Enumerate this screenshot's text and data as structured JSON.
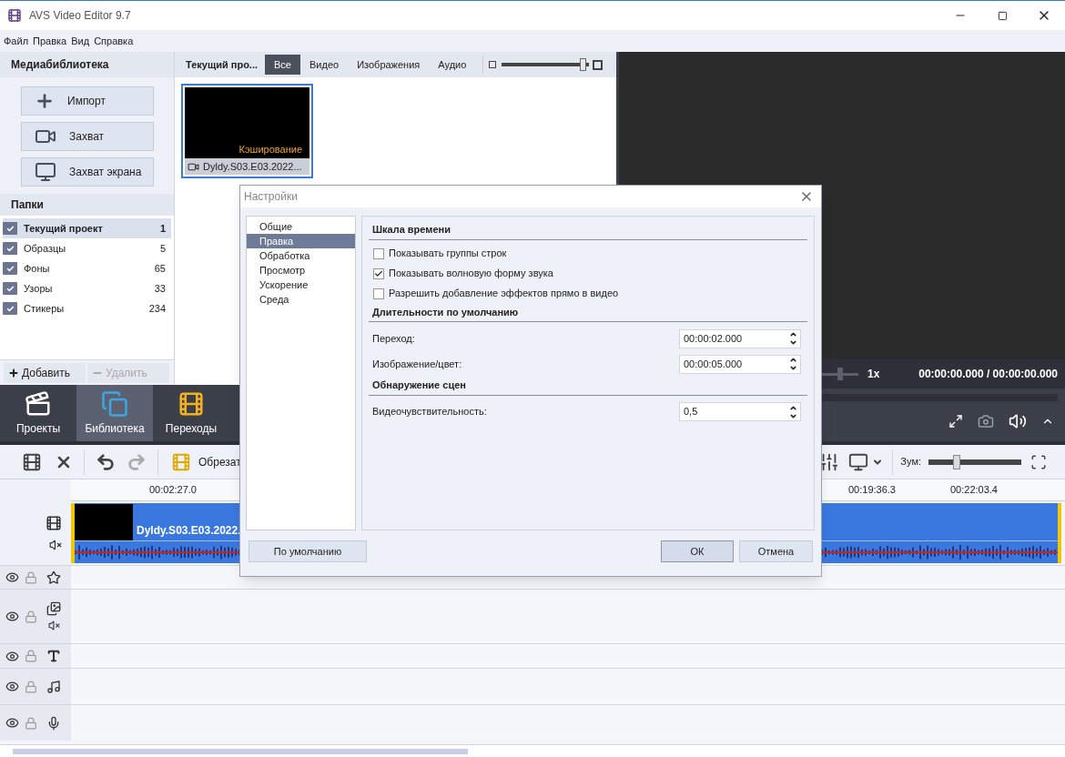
{
  "window": {
    "title": "AVS Video Editor 9.7"
  },
  "menu": [
    "Файл",
    "Правка",
    "Вид",
    "Справка"
  ],
  "media_library": {
    "title": "Медиабиблиотека",
    "buttons": [
      {
        "label": "Импорт",
        "kind": "import"
      },
      {
        "label": "Захват",
        "kind": "capture"
      },
      {
        "label": "Захват экрана",
        "kind": "screen"
      }
    ]
  },
  "folders": {
    "title": "Папки",
    "items": [
      {
        "name": "Текущий проект",
        "count": "1",
        "selected": true
      },
      {
        "name": "Образцы",
        "count": "5",
        "selected": false
      },
      {
        "name": "Фоны",
        "count": "65",
        "selected": false
      },
      {
        "name": "Узоры",
        "count": "33",
        "selected": false
      },
      {
        "name": "Стикеры",
        "count": "234",
        "selected": false
      }
    ],
    "add": {
      "label": "Добавить",
      "disabled": false
    },
    "remove": {
      "label": "Удалить",
      "disabled": true
    }
  },
  "browser": {
    "title": "Текущий про...",
    "filters": [
      {
        "label": "Все",
        "selected": true
      },
      {
        "label": "Видео",
        "selected": false
      },
      {
        "label": "Изображения",
        "selected": false
      },
      {
        "label": "Аудио",
        "selected": false
      }
    ],
    "size_slider": {
      "level": 0.97
    },
    "items": [
      {
        "name": "Dyldy.S03.E03.2022...",
        "status": "Кэширование",
        "selected": true
      }
    ]
  },
  "preview": {
    "speed_slider": {
      "level": 0.5
    },
    "speed": "1x",
    "time": "00:00:00.000 / 00:00:00.000"
  },
  "nav_tabs": [
    {
      "label": "Проекты",
      "kind": "projects",
      "selected": false
    },
    {
      "label": "Библиотека",
      "kind": "library",
      "selected": true
    },
    {
      "label": "Переходы",
      "kind": "transitions",
      "selected": false
    }
  ],
  "toolbar": {
    "trim_label": "Обрезат",
    "zoom_label": "Зум:",
    "zoom_slider": {
      "level": 0.3
    }
  },
  "timeline": {
    "ruler": [
      "00:02:27.0",
      "00:19:36.3",
      "00:22:03.4"
    ],
    "clip": {
      "title": "Dyldy.S03.E03.2022."
    },
    "tracks": [
      {
        "kind": "effects"
      },
      {
        "kind": "overlay"
      },
      {
        "kind": "text"
      },
      {
        "kind": "music"
      },
      {
        "kind": "voice"
      }
    ]
  },
  "dialog": {
    "title": "Настройки",
    "categories": [
      {
        "label": "Общие",
        "selected": false
      },
      {
        "label": "Правка",
        "selected": true
      },
      {
        "label": "Обработка",
        "selected": false
      },
      {
        "label": "Просмотр",
        "selected": false
      },
      {
        "label": "Ускорение",
        "selected": false
      },
      {
        "label": "Среда",
        "selected": false
      }
    ],
    "sections": [
      {
        "title": "Шкала времени",
        "rows": [
          {
            "kind": "checkbox",
            "label": "Показывать группы строк",
            "checked": false
          },
          {
            "kind": "checkbox",
            "label": "Показывать волновую форму звука",
            "checked": true
          },
          {
            "kind": "checkbox",
            "label": "Разрешить добавление эффектов прямо в видео",
            "checked": false
          }
        ]
      },
      {
        "title": "Длительности по умолчанию",
        "rows": [
          {
            "kind": "spin",
            "label": "Переход:",
            "value": "00:00:02.000"
          },
          {
            "kind": "spin",
            "label": "Изображение/цвет:",
            "value": "00:00:05.000"
          }
        ]
      },
      {
        "title": "Обнаружение сцен",
        "rows": [
          {
            "kind": "spin",
            "label": "Видеочувствительность:",
            "value": "0,5"
          }
        ]
      }
    ],
    "defaults": "По умолчанию",
    "ok": "ОК",
    "cancel": "Отмена"
  }
}
